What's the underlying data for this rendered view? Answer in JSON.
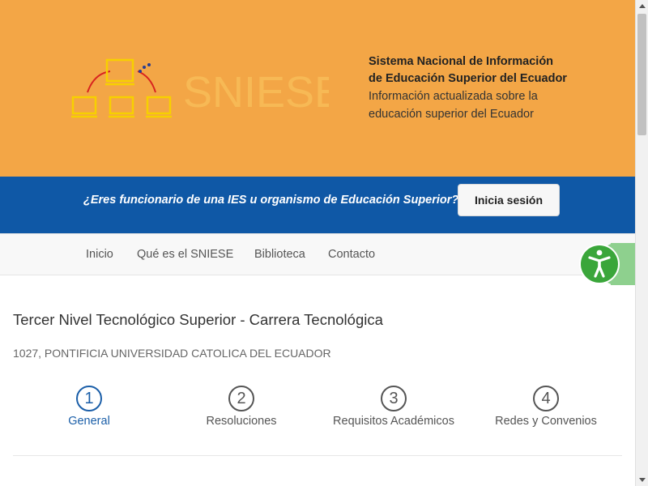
{
  "header": {
    "logo_text": "SNIESE",
    "title_line1": "Sistema Nacional de Información",
    "title_line2": "de Educación Superior del Ecuador",
    "subtitle_line1": "Información actualizada sobre la",
    "subtitle_line2": "educación superior del Ecuador",
    "background_color": "#f3a646"
  },
  "login_bar": {
    "question": "¿Eres funcionario de una IES u organismo de Educación Superior?",
    "button_label": "Inicia sesión",
    "background_color": "#0f58a6"
  },
  "nav": {
    "items": [
      {
        "label": "Inicio"
      },
      {
        "label": "Qué es el SNIESE"
      },
      {
        "label": "Biblioteca"
      },
      {
        "label": "Contacto"
      }
    ]
  },
  "accessibility": {
    "icon": "accessibility-person-icon",
    "color": "#3aa63a"
  },
  "main": {
    "title": "Tercer Nivel Tecnológico Superior - Carrera Tecnológica",
    "subtitle": "1027, PONTIFICIA UNIVERSIDAD CATOLICA DEL ECUADOR",
    "steps": [
      {
        "number": "1",
        "label": "General",
        "active": true
      },
      {
        "number": "2",
        "label": "Resoluciones",
        "active": false
      },
      {
        "number": "3",
        "label": "Requisitos Académicos",
        "active": false
      },
      {
        "number": "4",
        "label": "Redes y Convenios",
        "active": false
      }
    ],
    "active_color": "#1a5ea8"
  }
}
